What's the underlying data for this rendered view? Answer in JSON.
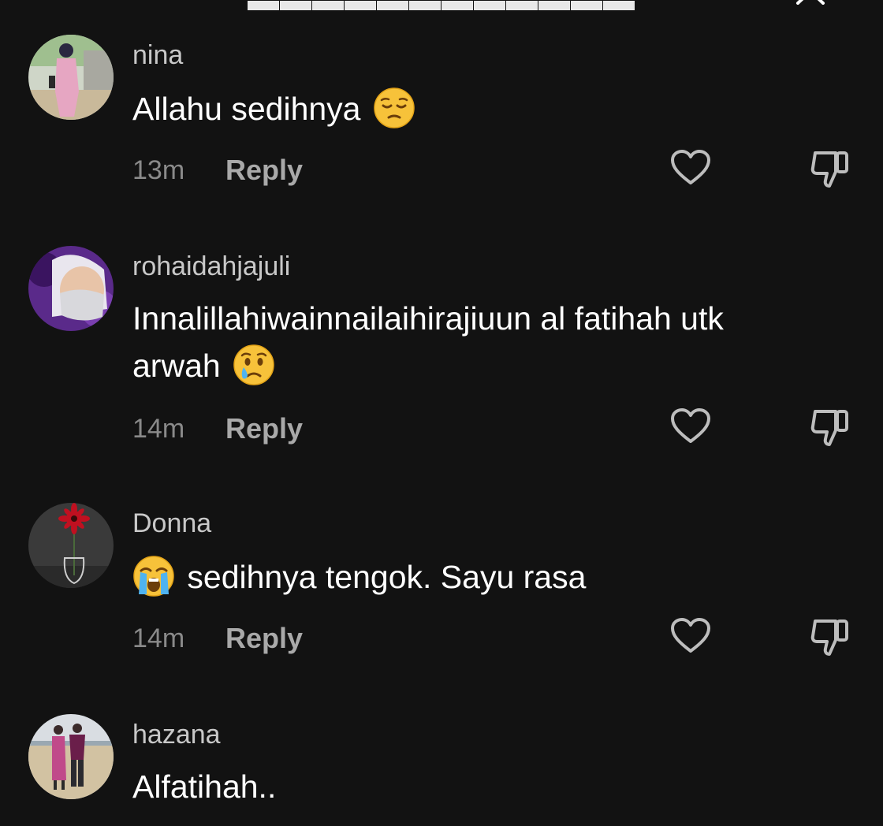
{
  "icons": {
    "close": "close-icon",
    "like": "heart-outline-icon",
    "dislike": "thumbs-down-icon"
  },
  "colors": {
    "background": "#121212",
    "username": "#c8c8c8",
    "comment_text": "#ffffff",
    "meta_text": "#8a8a8a",
    "reply_text": "#a9a9a9"
  },
  "comments": [
    {
      "username": "nina",
      "text": "Allahu sedihnya",
      "emoji": "pensive-face-emoji",
      "time": "13m",
      "reply_label": "Reply"
    },
    {
      "username": "rohaidahjajuli",
      "text_line1": "Innalillahiwainnailaihirajiuun al fatihah utk",
      "text_line2": "arwah",
      "emoji": "crying-face-emoji",
      "time": "14m",
      "reply_label": "Reply"
    },
    {
      "username": "Donna",
      "emoji": "loudly-crying-face-emoji",
      "text": "sedihnya tengok. Sayu rasa",
      "time": "14m",
      "reply_label": "Reply"
    },
    {
      "username": "hazana",
      "text": "Alfatihah.."
    }
  ]
}
